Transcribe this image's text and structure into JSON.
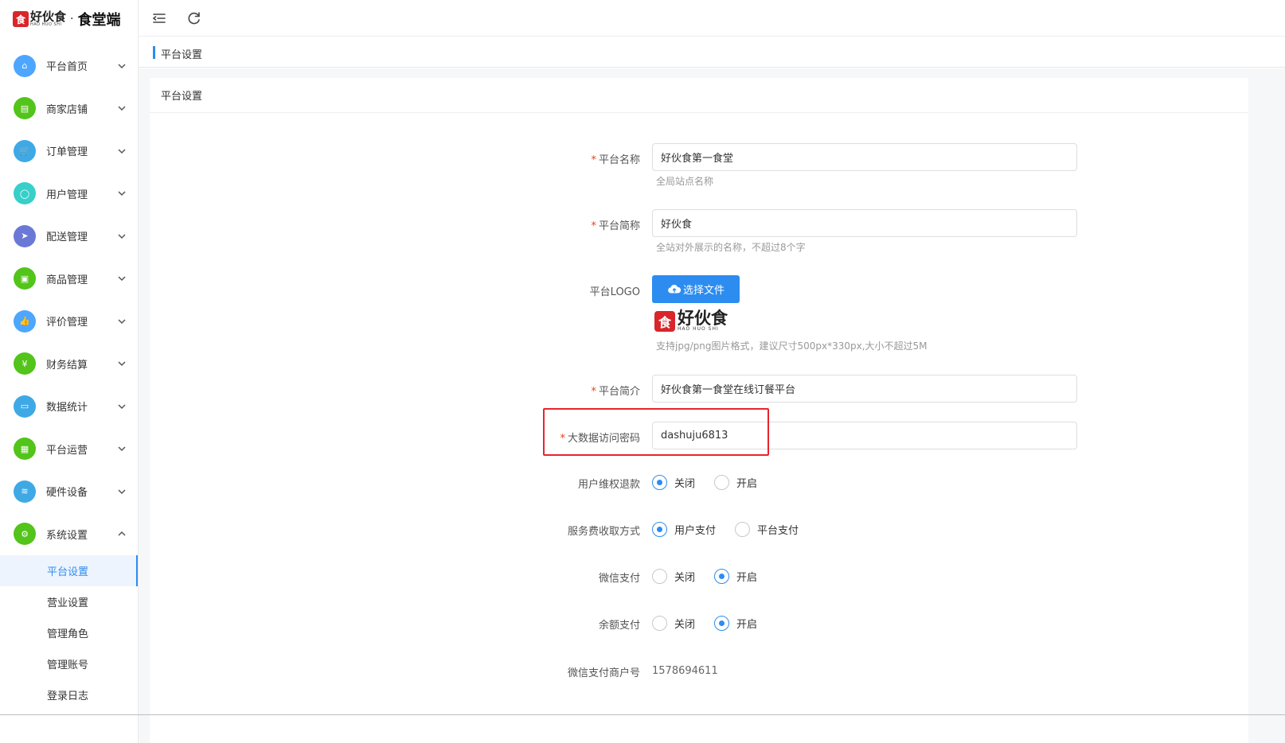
{
  "brand": {
    "mark": "食",
    "name_cn": "好伙食",
    "name_en": "HAO HUO SHI",
    "separator": "·",
    "suffix": "食堂端"
  },
  "sidebar": {
    "items": [
      {
        "label": "平台首页",
        "icon": "home-icon",
        "color": "#4da6ff",
        "glyph": "⌂"
      },
      {
        "label": "商家店铺",
        "icon": "store-icon",
        "color": "#52c41a",
        "glyph": "▤"
      },
      {
        "label": "订单管理",
        "icon": "cart-icon",
        "color": "#3fa9e6",
        "glyph": "🛒"
      },
      {
        "label": "用户管理",
        "icon": "user-icon",
        "color": "#36cfc9",
        "glyph": "◯"
      },
      {
        "label": "配送管理",
        "icon": "send-icon",
        "color": "#6b79d6",
        "glyph": "➤"
      },
      {
        "label": "商品管理",
        "icon": "goods-icon",
        "color": "#52c41a",
        "glyph": "▣"
      },
      {
        "label": "评价管理",
        "icon": "thumb-icon",
        "color": "#4da6ff",
        "glyph": "👍"
      },
      {
        "label": "财务结算",
        "icon": "finance-icon",
        "color": "#52c41a",
        "glyph": "¥"
      },
      {
        "label": "数据统计",
        "icon": "monitor-icon",
        "color": "#3fa9e6",
        "glyph": "▭"
      },
      {
        "label": "平台运营",
        "icon": "gift-icon",
        "color": "#52c41a",
        "glyph": "▦"
      },
      {
        "label": "硬件设备",
        "icon": "wifi-icon",
        "color": "#3fa9e6",
        "glyph": "≋"
      },
      {
        "label": "系统设置",
        "icon": "settings-icon",
        "color": "#52c41a",
        "glyph": "⚙"
      }
    ],
    "submenu": [
      {
        "label": "平台设置",
        "active": true
      },
      {
        "label": "营业设置",
        "active": false
      },
      {
        "label": "管理角色",
        "active": false
      },
      {
        "label": "管理账号",
        "active": false
      },
      {
        "label": "登录日志",
        "active": false
      }
    ]
  },
  "breadcrumb": {
    "current": "平台设置"
  },
  "card": {
    "title": "平台设置"
  },
  "form": {
    "platform_name": {
      "label": "平台名称",
      "value": "好伙食第一食堂",
      "hint": "全局站点名称",
      "required": true
    },
    "platform_short": {
      "label": "平台简称",
      "value": "好伙食",
      "hint": "全站对外展示的名称，不超过8个字",
      "required": true
    },
    "platform_logo": {
      "label": "平台LOGO",
      "button": "选择文件",
      "hint": "支持jpg/png图片格式，建议尺寸500px*330px,大小不超过5M"
    },
    "platform_intro": {
      "label": "平台简介",
      "value": "好伙食第一食堂在线订餐平台",
      "required": true
    },
    "bigdata_password": {
      "label": "大数据访问密码",
      "value": "dashuju6813",
      "required": true
    },
    "refund": {
      "label": "用户维权退款",
      "options": [
        "关闭",
        "开启"
      ],
      "selected": "关闭"
    },
    "service_fee": {
      "label": "服务费收取方式",
      "options": [
        "用户支付",
        "平台支付"
      ],
      "selected": "用户支付"
    },
    "wechat_pay": {
      "label": "微信支付",
      "options": [
        "关闭",
        "开启"
      ],
      "selected": "开启"
    },
    "balance_pay": {
      "label": "余额支付",
      "options": [
        "关闭",
        "开启"
      ],
      "selected": "开启"
    },
    "wechat_mch": {
      "label": "微信支付商户号",
      "value": "1578694611"
    }
  },
  "colors": {
    "accent": "#2d8cf0",
    "required": "#ed4014",
    "highlight": "#e8242a"
  }
}
